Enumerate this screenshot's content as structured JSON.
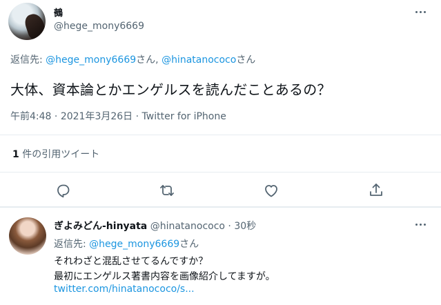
{
  "main_tweet": {
    "display_name": "鵺",
    "handle": "@hege_mony6669",
    "replying_label": "返信先: ",
    "replying_users": [
      {
        "handle": "@hege_mony6669",
        "suffix": "さん, "
      },
      {
        "handle": "@hinatanococo",
        "suffix": "さん"
      }
    ],
    "text": "大体、資本論とかエンゲルスを読んだことあるの？",
    "time": "午前4:48",
    "separator": " · ",
    "date": "2021年3月26日",
    "source": "Twitter for iPhone",
    "quote_count": "1",
    "quote_label": " 件の引用ツイート"
  },
  "actions": {
    "reply_icon": "speech-bubble-icon",
    "retweet_icon": "retweet-icon",
    "like_icon": "heart-icon",
    "share_icon": "share-icon"
  },
  "reply_tweet": {
    "display_name": "ぎよみどん-hinyata",
    "handle": "@hinatanococo",
    "time": " · 30秒",
    "replying_label": "返信先: ",
    "replying_handle": "@hege_mony6669",
    "replying_suffix": "さん",
    "line1": "それわざと混乱させてるんですか？",
    "line2": "最初にエンゲルス著書内容を画像紹介してますが。",
    "link": "twitter.com/hinatanococo/s..."
  },
  "colors": {
    "link": "#1b95e0",
    "muted": "#536471",
    "divider": "#e6ecf0"
  }
}
